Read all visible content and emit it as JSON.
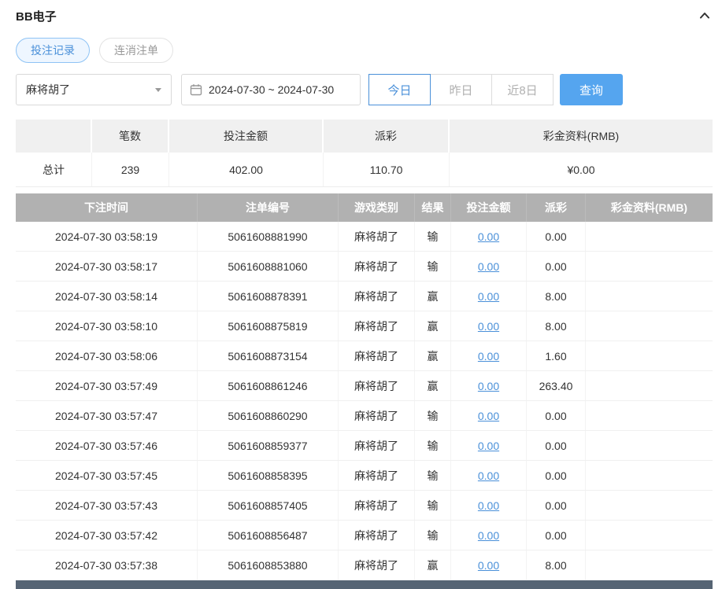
{
  "panel": {
    "title": "BB电子"
  },
  "tabs": [
    {
      "label": "投注记录",
      "active": true
    },
    {
      "label": "连消注单",
      "active": false
    }
  ],
  "filters": {
    "game_select": {
      "value": "麻将胡了"
    },
    "date_range": {
      "value": "2024-07-30 ~ 2024-07-30"
    },
    "quick_ranges": [
      {
        "label": "今日",
        "active": true
      },
      {
        "label": "昨日",
        "active": false
      },
      {
        "label": "近8日",
        "active": false
      }
    ],
    "search_button": "查询"
  },
  "summary": {
    "headers": [
      "",
      "笔数",
      "投注金额",
      "派彩",
      "彩金资料(RMB)"
    ],
    "row": {
      "label": "总计",
      "count": "239",
      "bet_amount": "402.00",
      "payout": "110.70",
      "bonus": "¥0.00"
    }
  },
  "table": {
    "headers": [
      "下注时间",
      "注单编号",
      "游戏类别",
      "结果",
      "投注金额",
      "派彩",
      "彩金资料(RMB)"
    ],
    "rows": [
      {
        "time": "2024-07-30 03:58:19",
        "order_id": "5061608881990",
        "game": "麻将胡了",
        "result": "输",
        "bet": "0.00",
        "payout": "0.00",
        "bonus": ""
      },
      {
        "time": "2024-07-30 03:58:17",
        "order_id": "5061608881060",
        "game": "麻将胡了",
        "result": "输",
        "bet": "0.00",
        "payout": "0.00",
        "bonus": ""
      },
      {
        "time": "2024-07-30 03:58:14",
        "order_id": "5061608878391",
        "game": "麻将胡了",
        "result": "赢",
        "bet": "0.00",
        "payout": "8.00",
        "bonus": ""
      },
      {
        "time": "2024-07-30 03:58:10",
        "order_id": "5061608875819",
        "game": "麻将胡了",
        "result": "赢",
        "bet": "0.00",
        "payout": "8.00",
        "bonus": ""
      },
      {
        "time": "2024-07-30 03:58:06",
        "order_id": "5061608873154",
        "game": "麻将胡了",
        "result": "赢",
        "bet": "0.00",
        "payout": "1.60",
        "bonus": ""
      },
      {
        "time": "2024-07-30 03:57:49",
        "order_id": "5061608861246",
        "game": "麻将胡了",
        "result": "赢",
        "bet": "0.00",
        "payout": "263.40",
        "bonus": ""
      },
      {
        "time": "2024-07-30 03:57:47",
        "order_id": "5061608860290",
        "game": "麻将胡了",
        "result": "输",
        "bet": "0.00",
        "payout": "0.00",
        "bonus": ""
      },
      {
        "time": "2024-07-30 03:57:46",
        "order_id": "5061608859377",
        "game": "麻将胡了",
        "result": "输",
        "bet": "0.00",
        "payout": "0.00",
        "bonus": ""
      },
      {
        "time": "2024-07-30 03:57:45",
        "order_id": "5061608858395",
        "game": "麻将胡了",
        "result": "输",
        "bet": "0.00",
        "payout": "0.00",
        "bonus": ""
      },
      {
        "time": "2024-07-30 03:57:43",
        "order_id": "5061608857405",
        "game": "麻将胡了",
        "result": "输",
        "bet": "0.00",
        "payout": "0.00",
        "bonus": ""
      },
      {
        "time": "2024-07-30 03:57:42",
        "order_id": "5061608856487",
        "game": "麻将胡了",
        "result": "输",
        "bet": "0.00",
        "payout": "0.00",
        "bonus": ""
      },
      {
        "time": "2024-07-30 03:57:38",
        "order_id": "5061608853880",
        "game": "麻将胡了",
        "result": "赢",
        "bet": "0.00",
        "payout": "8.00",
        "bonus": ""
      }
    ]
  },
  "colors": {
    "accent_blue": "#4a90d9",
    "search_button_blue": "#55a5ef",
    "table_header_gray": "#b1b1b1",
    "summary_header_gray": "#f0f0f0",
    "link_blue": "#4a90d9",
    "muted_text": "#b0b0b0",
    "bottom_bar": "#566474"
  }
}
